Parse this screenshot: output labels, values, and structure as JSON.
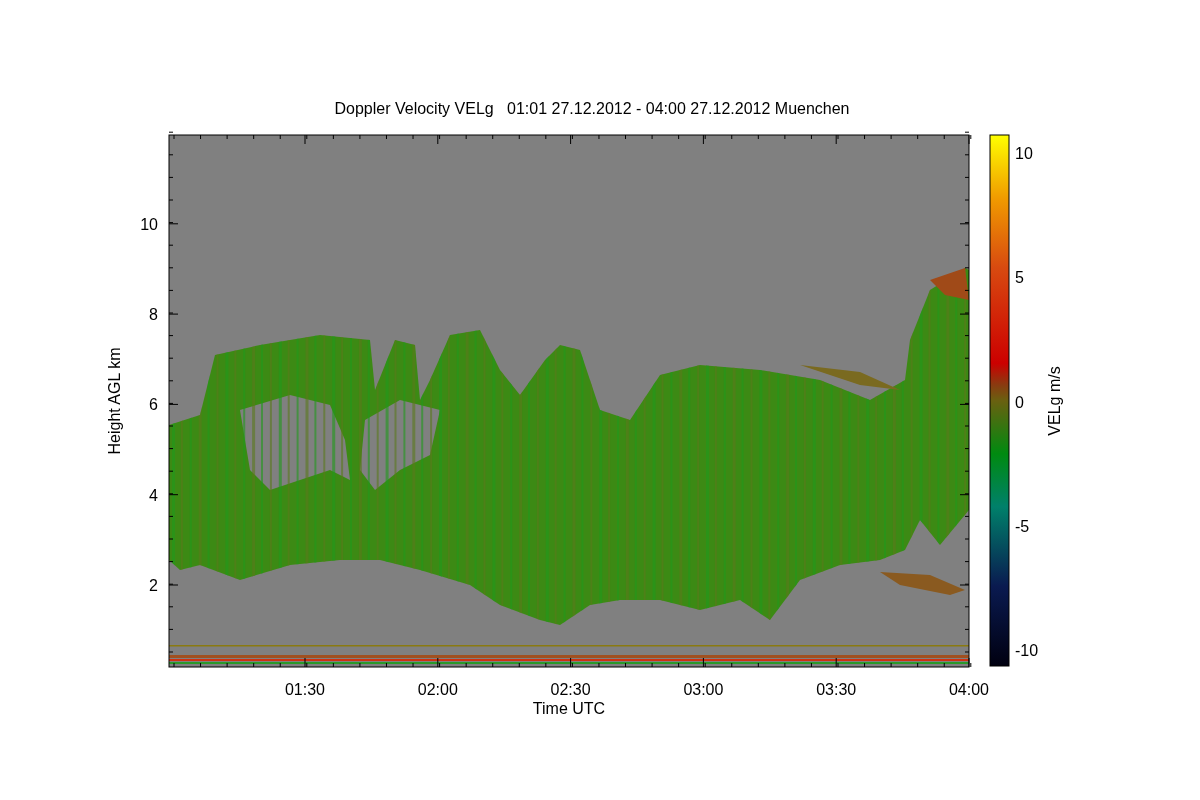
{
  "title": "Doppler Velocity VELg   01:01 27.12.2012 - 04:00 27.12.2012 Muenchen",
  "xlabel": "Time UTC",
  "ylabel": "Height AGL km",
  "xticks": [
    "01:30",
    "02:00",
    "02:30",
    "03:00",
    "03:30",
    "04:00"
  ],
  "yticks": [
    "10",
    "8",
    "6",
    "4",
    "2"
  ],
  "colorbar": {
    "label": "VELg m/s",
    "ticks": [
      "10",
      "5",
      "0",
      "-5",
      "-10"
    ]
  }
}
